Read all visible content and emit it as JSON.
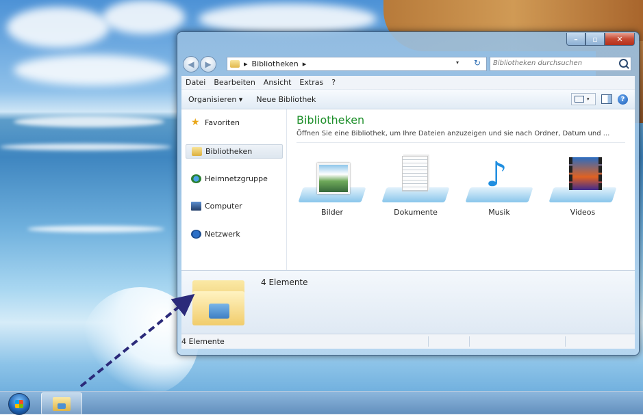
{
  "window": {
    "controls": {
      "minimize": "–",
      "maximize": "▫",
      "close": "✕"
    }
  },
  "address": {
    "back_glyph": "◀",
    "forward_glyph": "▶",
    "path_sep_1": "▸",
    "path": "Bibliotheken",
    "path_sep_2": "▸",
    "dropdown_glyph": "▾",
    "refresh_glyph": "↻",
    "search_placeholder": "Bibliotheken durchsuchen"
  },
  "menubar": [
    "Datei",
    "Bearbeiten",
    "Ansicht",
    "Extras",
    "?"
  ],
  "toolbar": {
    "organize": "Organisieren ▾",
    "new_library": "Neue Bibliothek",
    "view_dropdown": "▾",
    "help": "?"
  },
  "nav": {
    "favorites": "Favoriten",
    "libraries": "Bibliotheken",
    "homegroup": "Heimnetzgruppe",
    "computer": "Computer",
    "network": "Netzwerk",
    "selected": "Bibliotheken"
  },
  "content": {
    "title": "Bibliotheken",
    "subtitle": "Öffnen Sie eine Bibliothek, um Ihre Dateien anzuzeigen und sie nach Ordner, Datum und ...",
    "libraries": [
      "Bilder",
      "Dokumente",
      "Musik",
      "Videos"
    ]
  },
  "details": {
    "count": "4 Elemente"
  },
  "statusbar": {
    "count": "4 Elemente"
  },
  "icons": {
    "favorites": "star-icon",
    "libraries": "libraries-folder-icon",
    "homegroup": "homegroup-icon",
    "computer": "computer-icon",
    "network": "network-icon",
    "music": "music-note-icon"
  },
  "colors": {
    "title_green": "#1e8f2a",
    "arrow": "#2b2a7a"
  }
}
